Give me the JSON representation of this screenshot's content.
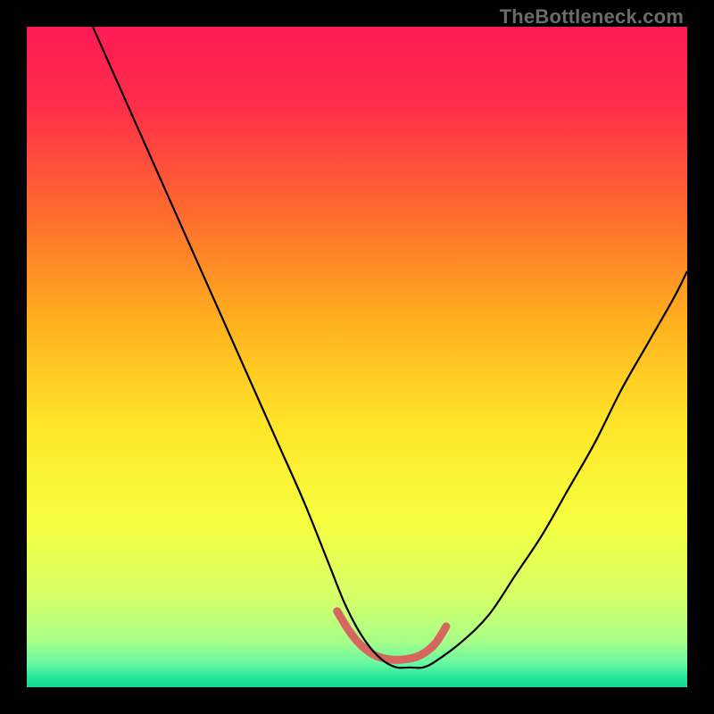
{
  "watermark": "TheBottleneck.com",
  "chart_data": {
    "type": "line",
    "title": "",
    "xlabel": "",
    "ylabel": "",
    "xlim": [
      0,
      100
    ],
    "ylim": [
      0,
      100
    ],
    "grid": false,
    "legend": false,
    "gradient_stops": [
      {
        "pos": 0.0,
        "color": "#ff1a55"
      },
      {
        "pos": 0.12,
        "color": "#ff2e4a"
      },
      {
        "pos": 0.28,
        "color": "#ff6a2e"
      },
      {
        "pos": 0.45,
        "color": "#ffb21e"
      },
      {
        "pos": 0.6,
        "color": "#ffe429"
      },
      {
        "pos": 0.75,
        "color": "#f6ff3f"
      },
      {
        "pos": 0.86,
        "color": "#d7ff66"
      },
      {
        "pos": 0.93,
        "color": "#a8ff88"
      },
      {
        "pos": 0.965,
        "color": "#64f7a4"
      },
      {
        "pos": 0.985,
        "color": "#27e59a"
      },
      {
        "pos": 1.0,
        "color": "#14d88f"
      }
    ],
    "series": [
      {
        "name": "bottleneck-curve",
        "color": "#000000",
        "width": 2.2,
        "x": [
          10,
          14,
          18,
          22,
          26,
          30,
          34,
          38,
          42,
          46,
          48,
          50,
          52,
          54,
          56,
          58,
          60,
          62,
          66,
          70,
          74,
          78,
          82,
          86,
          90,
          94,
          98,
          100
        ],
        "y": [
          100,
          91,
          82,
          73,
          64,
          55,
          46,
          37,
          28,
          18,
          13,
          9,
          6,
          4,
          3,
          3,
          3,
          4,
          7,
          11,
          17,
          23,
          30,
          37,
          45,
          52,
          59,
          63
        ]
      },
      {
        "name": "optimal-region-marker",
        "color": "#d6675f",
        "width": 9,
        "linecap": "round",
        "x": [
          47,
          48.5,
          50,
          51.5,
          53,
          55,
          57,
          59,
          60.5,
          62,
          63.5
        ],
        "y": [
          11.5,
          9.0,
          7.0,
          5.6,
          4.7,
          4.2,
          4.2,
          4.6,
          5.4,
          6.8,
          9.2
        ]
      }
    ]
  }
}
